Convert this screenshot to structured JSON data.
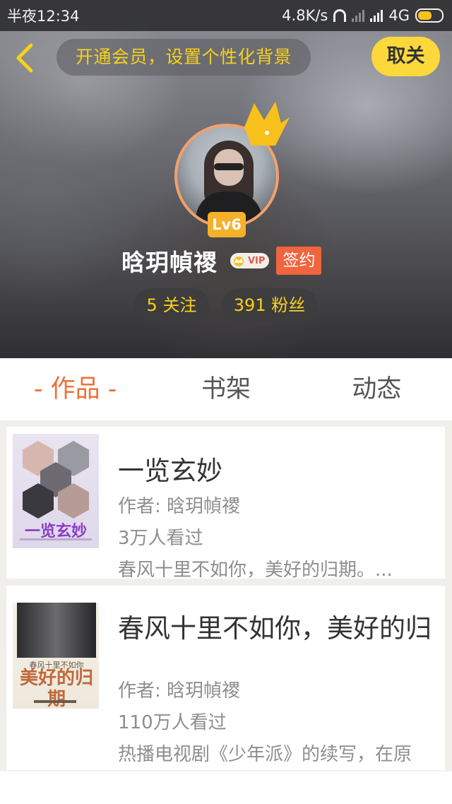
{
  "status_bar": {
    "time": "半夜12:34",
    "network_speed": "4.8K/s",
    "network_type": "4G"
  },
  "header": {
    "banner_text": "开通会员，设置个性化背景",
    "close_label": "取关",
    "accent_color": "#fcd83b"
  },
  "profile": {
    "level": "Lv6",
    "username": "晗玥幀禝",
    "vip_label": "VIP",
    "sign_label": "签约",
    "following": "5 关注",
    "fans": "391 粉丝"
  },
  "tabs": [
    {
      "label": "- 作品 -",
      "active": true
    },
    {
      "label": "书架",
      "active": false
    },
    {
      "label": "动态",
      "active": false
    }
  ],
  "books": [
    {
      "title": "一览玄妙",
      "cover_text": "一览玄妙",
      "author": "作者: 晗玥幀禝",
      "views": "3万人看过",
      "description": "春风十里不如你，美好的归期。..."
    },
    {
      "title": "春风十里不如你，美好的归",
      "cover_text": "美好的归期",
      "cover_subtext": "春风十里不如你",
      "author": "作者: 晗玥幀禝",
      "views": "110万人看过",
      "description": "热播电视剧《少年派》的续写，在原"
    }
  ]
}
